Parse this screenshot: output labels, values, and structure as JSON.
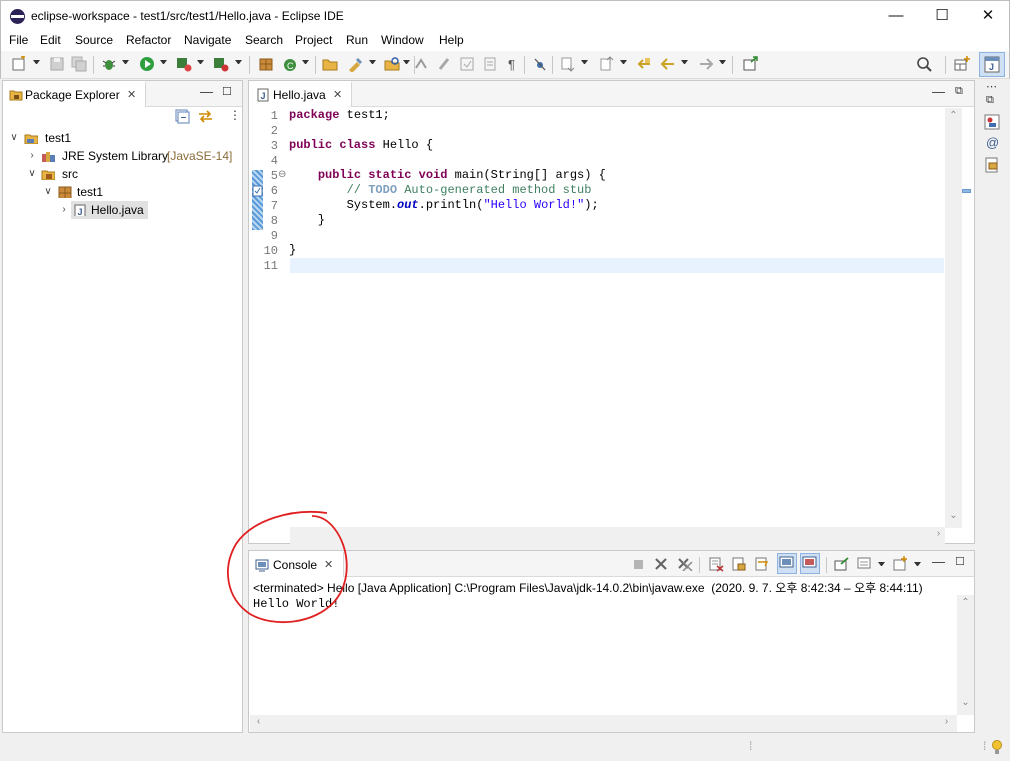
{
  "window": {
    "title": "eclipse-workspace - test1/src/test1/Hello.java - Eclipse IDE",
    "min_glyph": "—",
    "max_glyph": "☐",
    "close_glyph": "✕"
  },
  "menu": [
    "File",
    "Edit",
    "Source",
    "Refactor",
    "Navigate",
    "Search",
    "Project",
    "Run",
    "Window",
    "Help"
  ],
  "package_explorer": {
    "tab_label": "Package Explorer",
    "tree": [
      {
        "label": "test1",
        "icon": "project-icon"
      },
      {
        "label": "JRE System Library",
        "decoration": "[JavaSE-14]",
        "icon": "library-icon"
      },
      {
        "label": "src",
        "icon": "source-folder-icon"
      },
      {
        "label": "test1",
        "icon": "package-icon"
      },
      {
        "label": "Hello.java",
        "icon": "java-file-icon"
      }
    ]
  },
  "editor": {
    "tab_label": "Hello.java",
    "line_numbers": [
      "1",
      "2",
      "3",
      "4",
      "5",
      "6",
      "7",
      "8",
      "9",
      "10",
      "11"
    ],
    "code": {
      "l1_kw": "package",
      "l1_rest": " test1;",
      "l3_kw": "public class",
      "l3_rest": " Hello {",
      "l5_indent": "    ",
      "l5_kw": "public static void",
      "l5_rest": " main(String[] args) {",
      "l6_indent": "        ",
      "l6_comment": "// ",
      "l6_todo": "TODO",
      "l6_comment_rest": " Auto-generated method stub",
      "l7_indent": "        ",
      "l7_a": "System.",
      "l7_field": "out",
      "l7_b": ".println(",
      "l7_str": "\"Hello World!\"",
      "l7_c": ");",
      "l8": "    }",
      "l10": "}"
    },
    "fold_marker": "⊖"
  },
  "console": {
    "tab_label": "Console",
    "status": "<terminated> Hello [Java Application] C:\\Program Files\\Java\\jdk-14.0.2\\bin\\javaw.exe  (2020. 9. 7. 오후 8:42:34 – 오후 8:44:11)",
    "output": "Hello World!"
  },
  "annotation": {
    "color": "#e02020"
  },
  "colors": {
    "keyword": "#7f0055",
    "comment": "#3f7f5f",
    "string": "#2a00ff",
    "current_line": "#e8f2fe"
  }
}
